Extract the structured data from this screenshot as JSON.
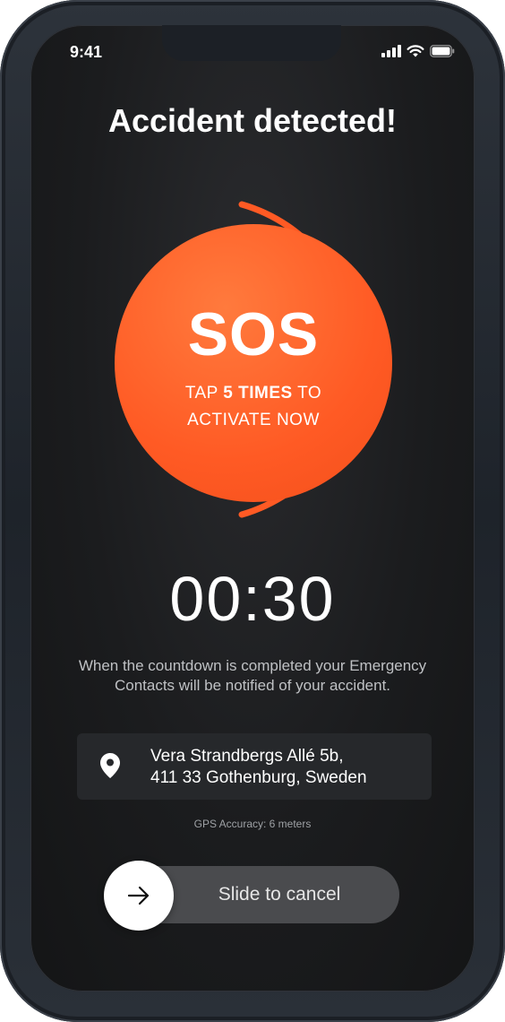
{
  "status_bar": {
    "time": "9:41",
    "icons": [
      "signal-icon",
      "wifi-icon",
      "battery-icon"
    ]
  },
  "title": "Accident detected!",
  "sos": {
    "label": "SOS",
    "line1_pre": "TAP ",
    "line1_bold": "5 TIMES",
    "line1_post": " TO",
    "line2": "ACTIVATE NOW",
    "color": "#FF5A24"
  },
  "countdown": "00:30",
  "info_text": "When the countdown is completed your Emergency Contacts will be notified of your accident.",
  "location": {
    "icon": "location-pin-icon",
    "line1": "Vera Strandbergs Allé 5b,",
    "line2": "411 33 Gothenburg, Sweden"
  },
  "gps_accuracy": "GPS Accuracy: 6 meters",
  "slider": {
    "label": "Slide to cancel",
    "icon": "arrow-right-icon"
  }
}
